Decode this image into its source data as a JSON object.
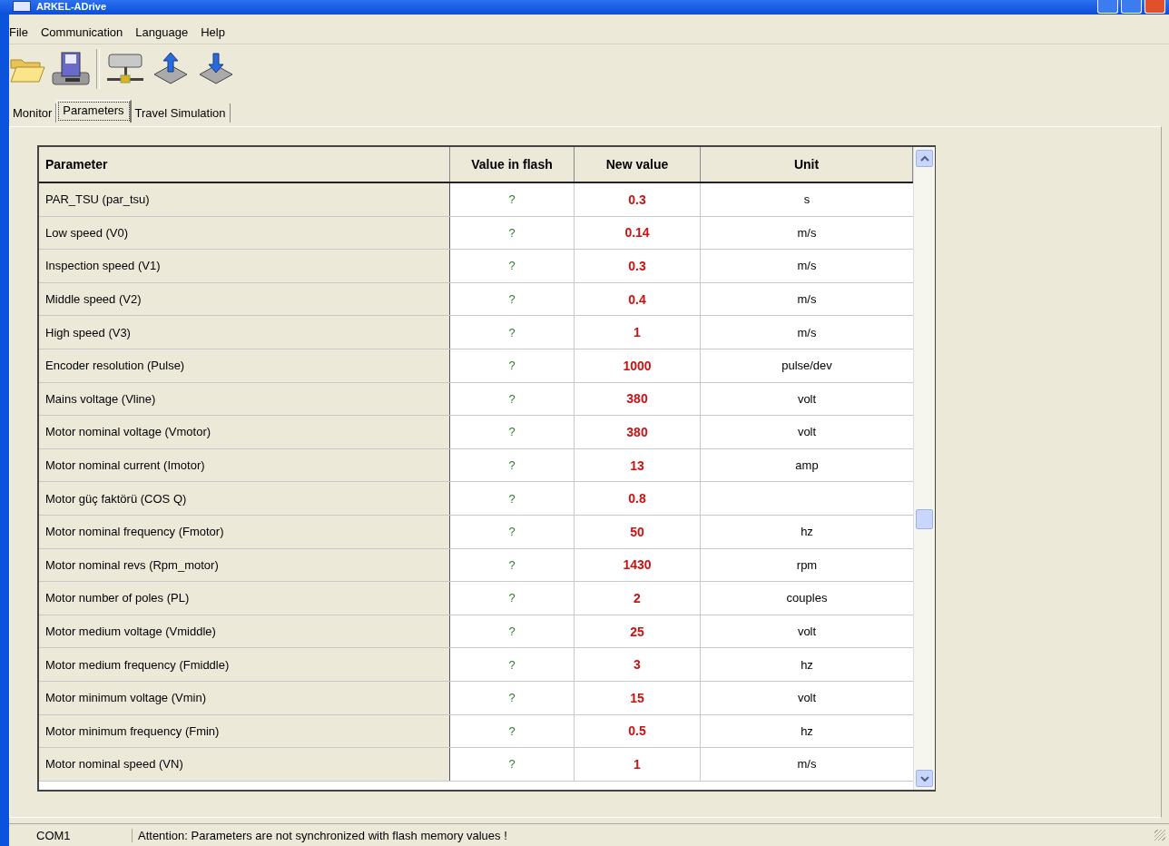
{
  "window": {
    "title": "ARKEL-ADrive"
  },
  "menu": [
    "File",
    "Communication",
    "Language",
    "Help"
  ],
  "toolbar": [
    {
      "kind": "open"
    },
    {
      "kind": "save"
    },
    {
      "kind": "sep"
    },
    {
      "kind": "network"
    },
    {
      "kind": "upload"
    },
    {
      "kind": "download"
    }
  ],
  "tabs": [
    {
      "label": "Monitor",
      "selected": false
    },
    {
      "label": "Parameters",
      "selected": true
    },
    {
      "label": "Travel Simulation",
      "selected": false
    }
  ],
  "table": {
    "columns": [
      "Parameter",
      "Value in flash",
      "New value",
      "Unit"
    ],
    "rows": [
      {
        "parameter": "PAR_TSU (par_tsu)",
        "flash": "?",
        "new": "0.3",
        "unit": "s"
      },
      {
        "parameter": "Low speed (V0)",
        "flash": "?",
        "new": "0.14",
        "unit": "m/s"
      },
      {
        "parameter": "Inspection speed (V1)",
        "flash": "?",
        "new": "0.3",
        "unit": "m/s"
      },
      {
        "parameter": "Middle speed (V2)",
        "flash": "?",
        "new": "0.4",
        "unit": "m/s"
      },
      {
        "parameter": "High speed (V3)",
        "flash": "?",
        "new": "1",
        "unit": "m/s"
      },
      {
        "parameter": "Encoder resolution (Pulse)",
        "flash": "?",
        "new": "1000",
        "unit": "pulse/dev"
      },
      {
        "parameter": "Mains voltage (Vline)",
        "flash": "?",
        "new": "380",
        "unit": "volt"
      },
      {
        "parameter": "Motor nominal voltage (Vmotor)",
        "flash": "?",
        "new": "380",
        "unit": "volt"
      },
      {
        "parameter": "Motor nominal current (Imotor)",
        "flash": "?",
        "new": "13",
        "unit": "amp"
      },
      {
        "parameter": "Motor güç faktörü (COS Q)",
        "flash": "?",
        "new": "0.8"
      },
      {
        "parameter": "Motor nominal frequency (Fmotor)",
        "flash": "?",
        "new": "50",
        "unit": "hz"
      },
      {
        "parameter": "Motor nominal revs (Rpm_motor)",
        "flash": "?",
        "new": "1430",
        "unit": "rpm"
      },
      {
        "parameter": "Motor number of poles (PL)",
        "flash": "?",
        "new": "2",
        "unit": "couples"
      },
      {
        "parameter": "Motor medium voltage (Vmiddle)",
        "flash": "?",
        "new": "25",
        "unit": "volt"
      },
      {
        "parameter": "Motor medium frequency (Fmiddle)",
        "flash": "?",
        "new": "3",
        "unit": "hz"
      },
      {
        "parameter": "Motor minimum voltage (Vmin)",
        "flash": "?",
        "new": "15",
        "unit": "volt"
      },
      {
        "parameter": "Motor minimum frequency (Fmin)",
        "flash": "?",
        "new": "0.5",
        "unit": "hz"
      },
      {
        "parameter": "Motor nominal speed (VN)",
        "flash": "?",
        "new": "1",
        "unit": "m/s"
      }
    ]
  },
  "status_bar": {
    "port": "COM1",
    "message": "Attention: Parameters are not synchronized with flash memory values !"
  }
}
